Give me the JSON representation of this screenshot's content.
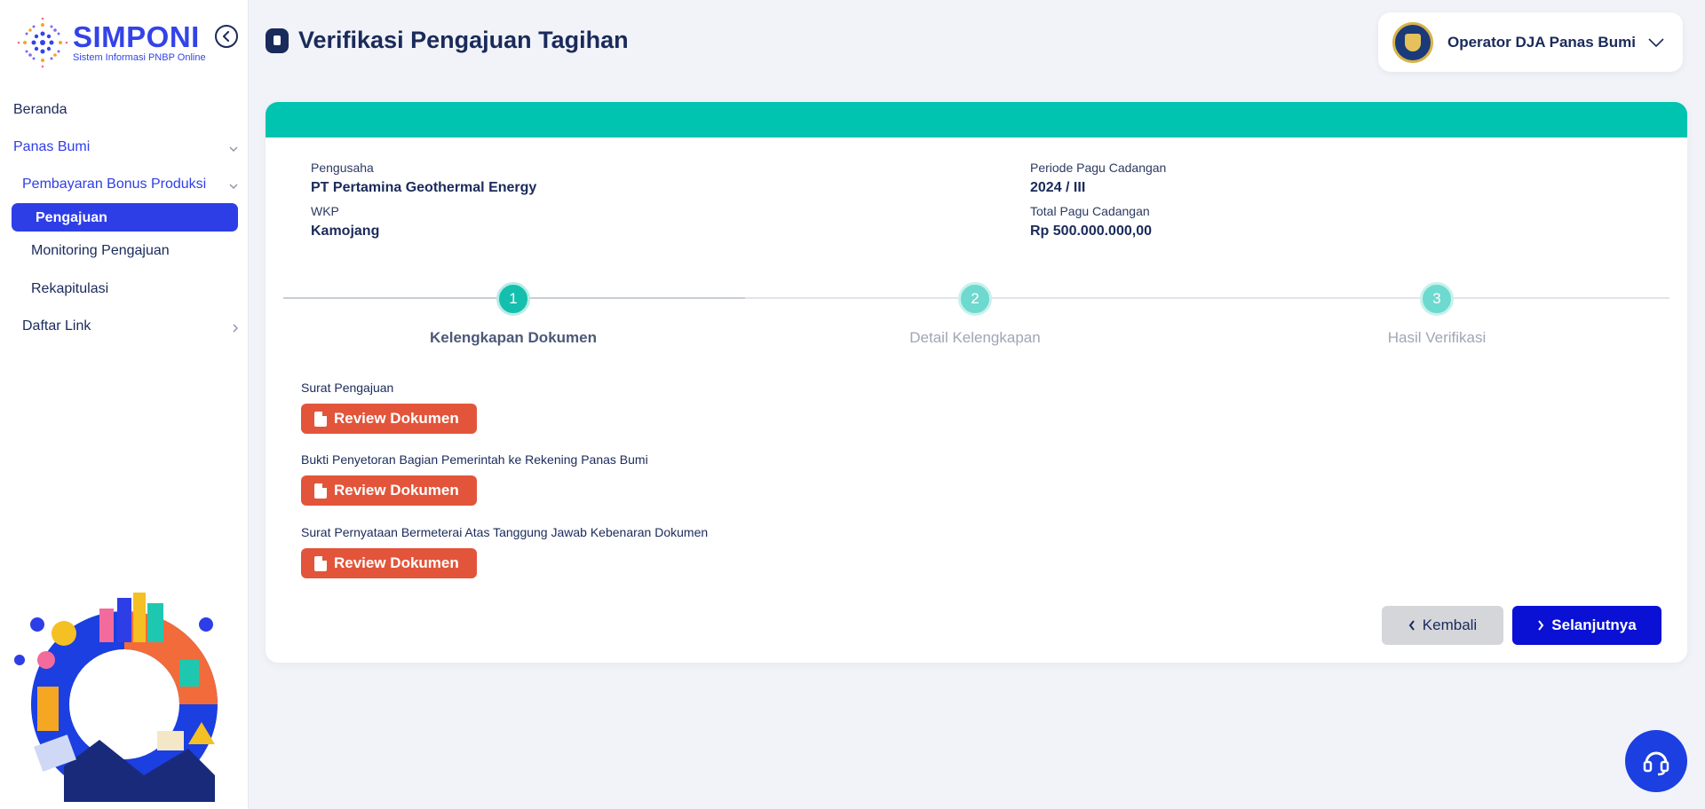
{
  "brand": {
    "title": "SIMPONI",
    "subtitle": "Sistem Informasi PNBP Online"
  },
  "sidebar": {
    "items": [
      {
        "label": "Beranda"
      },
      {
        "label": "Panas Bumi"
      },
      {
        "label": "Pembayaran Bonus Produksi"
      },
      {
        "label": "Pengajuan"
      },
      {
        "label": "Monitoring Pengajuan"
      },
      {
        "label": "Rekapitulasi"
      },
      {
        "label": "Daftar Link"
      }
    ]
  },
  "header": {
    "title": "Verifikasi Pengajuan Tagihan",
    "user": "Operator DJA Panas Bumi"
  },
  "info": {
    "pengusaha_label": "Pengusaha",
    "pengusaha_value": "PT Pertamina Geothermal Energy",
    "wkp_label": "WKP",
    "wkp_value": "Kamojang",
    "periode_label": "Periode Pagu Cadangan",
    "periode_value": "2024 / III",
    "total_label": "Total Pagu Cadangan",
    "total_value": "Rp 500.000.000,00"
  },
  "steps": [
    {
      "number": "1",
      "label": "Kelengkapan Dokumen",
      "state": "active"
    },
    {
      "number": "2",
      "label": "Detail Kelengkapan",
      "state": "inactive"
    },
    {
      "number": "3",
      "label": "Hasil Verifikasi",
      "state": "inactive"
    }
  ],
  "documents": [
    {
      "label": "Surat Pengajuan",
      "button": "Review Dokumen"
    },
    {
      "label": "Bukti Penyetoran Bagian Pemerintah ke Rekening Panas Bumi",
      "button": "Review Dokumen"
    },
    {
      "label": "Surat Pernyataan Bermeterai Atas Tanggung Jawab Kebenaran Dokumen",
      "button": "Review Dokumen"
    }
  ],
  "actions": {
    "back": "Kembali",
    "next": "Selanjutnya"
  },
  "colors": {
    "accent": "#2e3ee6",
    "teal": "#00c4b0",
    "review": "#e2553a",
    "primary_button": "#0a11d4"
  }
}
